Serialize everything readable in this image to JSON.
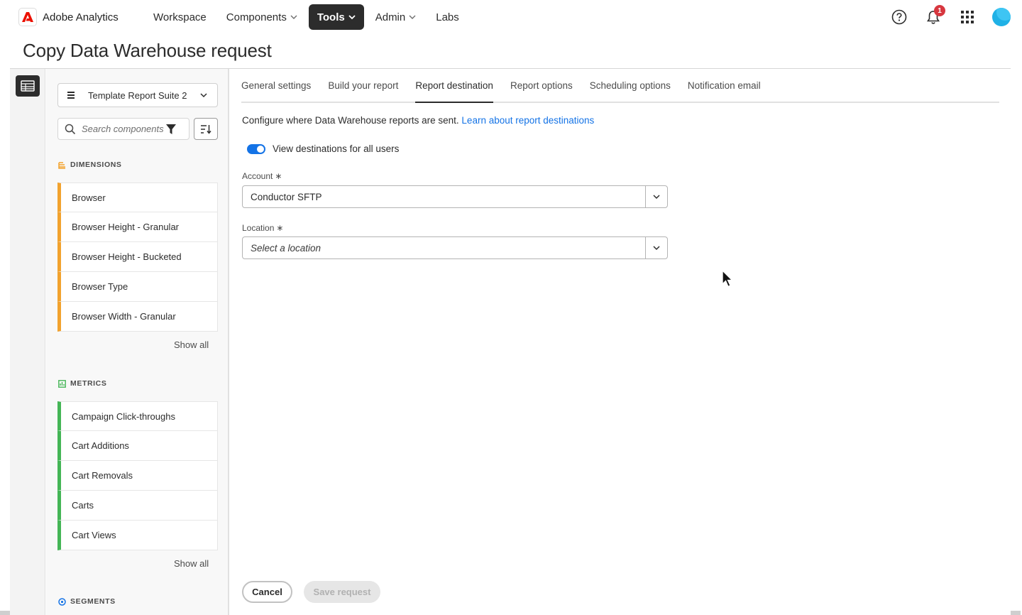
{
  "app": {
    "name": "Adobe Analytics"
  },
  "nav": {
    "items": [
      {
        "label": "Workspace",
        "has_menu": false,
        "active": false
      },
      {
        "label": "Components",
        "has_menu": true,
        "active": false
      },
      {
        "label": "Tools",
        "has_menu": true,
        "active": true
      },
      {
        "label": "Admin",
        "has_menu": true,
        "active": false
      },
      {
        "label": "Labs",
        "has_menu": false,
        "active": false
      }
    ],
    "notification_count": "1"
  },
  "page": {
    "title": "Copy Data Warehouse request"
  },
  "panel": {
    "report_suite": "Template Report Suite 2",
    "search_placeholder": "Search components",
    "dimensions": {
      "heading": "DIMENSIONS",
      "items": [
        "Browser",
        "Browser Height - Granular",
        "Browser Height - Bucketed",
        "Browser Type",
        "Browser Width - Granular"
      ],
      "show_all": "Show all"
    },
    "metrics": {
      "heading": "METRICS",
      "items": [
        "Campaign Click-throughs",
        "Cart Additions",
        "Cart Removals",
        "Carts",
        "Cart Views"
      ],
      "show_all": "Show all"
    },
    "segments": {
      "heading": "SEGMENTS"
    }
  },
  "tabs": [
    {
      "label": "General settings",
      "active": false
    },
    {
      "label": "Build your report",
      "active": false
    },
    {
      "label": "Report destination",
      "active": true
    },
    {
      "label": "Report options",
      "active": false
    },
    {
      "label": "Scheduling options",
      "active": false
    },
    {
      "label": "Notification email",
      "active": false
    }
  ],
  "destination": {
    "description": "Configure where Data Warehouse reports are sent.",
    "learn_link": "Learn about report destinations",
    "toggle_label": "View destinations for all users",
    "toggle_on": true,
    "account_label": "Account",
    "account_value": "Conductor SFTP",
    "location_label": "Location",
    "location_placeholder": "Select a location",
    "required_mark": "∗"
  },
  "actions": {
    "cancel": "Cancel",
    "save": "Save request"
  },
  "colors": {
    "accent": "#1473e6",
    "dimension": "#f2a22e",
    "metric": "#44b556",
    "brand_red": "#eb1000",
    "dark": "#2c2c2c"
  }
}
